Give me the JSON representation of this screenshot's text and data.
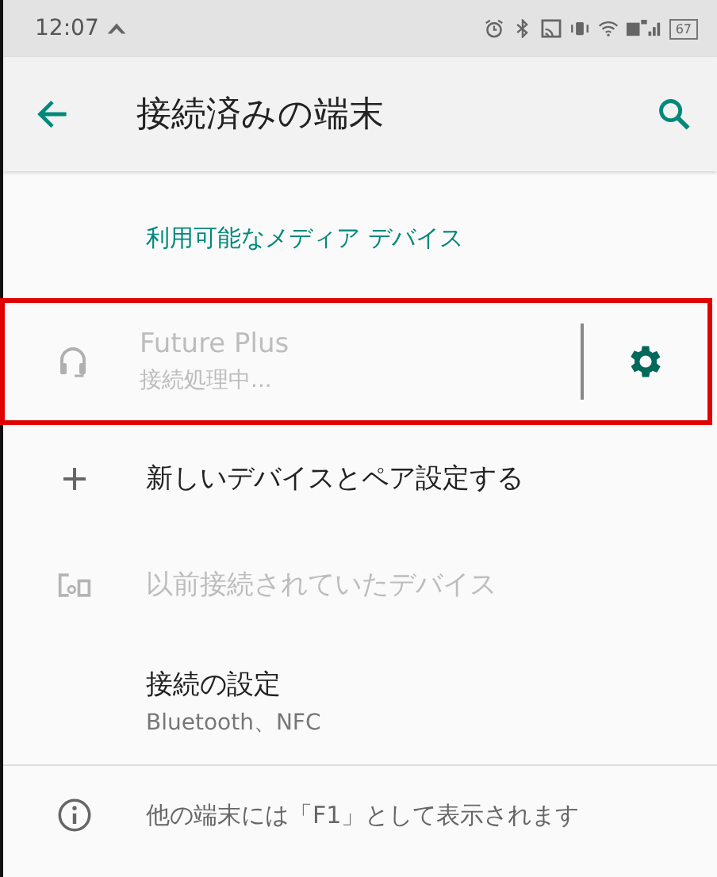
{
  "status_bar": {
    "time": "12:07",
    "battery": "67"
  },
  "app_bar": {
    "title": "接続済みの端末"
  },
  "section_header": "利用可能なメディア デバイス",
  "device": {
    "name": "Future Plus",
    "status": "接続処理中...",
    "disabled": true,
    "highlighted": true
  },
  "items": [
    {
      "kind": "add",
      "label": "新しいデバイスとペア設定する",
      "disabled": false
    },
    {
      "kind": "previous",
      "label": "以前接続されていたデバイス",
      "disabled": true
    },
    {
      "kind": "settings",
      "label": "接続の設定",
      "summary": "Bluetooth、NFC",
      "disabled": false
    }
  ],
  "footer": {
    "text": "他の端末には「F1」として表示されます"
  }
}
